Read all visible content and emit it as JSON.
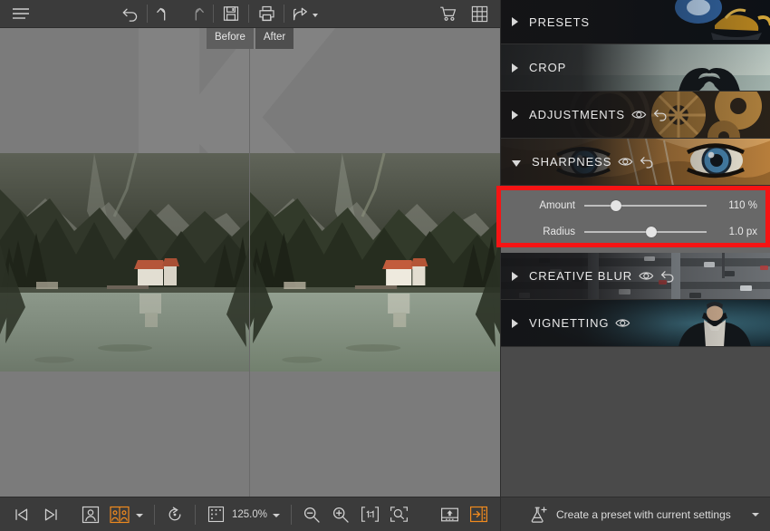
{
  "app": {
    "accent_color": "#f08a1e",
    "annotation_color": "#f51414",
    "panel_bg": "#4a4a4a",
    "toolbar_bg": "#3b3b3b",
    "slider_panel_bg": "#686868"
  },
  "top_toolbar": {
    "items": [
      {
        "name": "menu-icon",
        "title": "Menu"
      },
      {
        "name": "undo-all-icon",
        "title": "Undo all"
      },
      {
        "name": "undo-icon",
        "title": "Undo"
      },
      {
        "name": "redo-icon",
        "title": "Redo"
      },
      {
        "name": "save-icon",
        "title": "Save"
      },
      {
        "name": "print-icon",
        "title": "Print"
      },
      {
        "name": "share-icon",
        "title": "Share"
      },
      {
        "name": "cart-icon",
        "title": "Shop"
      },
      {
        "name": "grid-icon",
        "title": "Grid view"
      }
    ]
  },
  "canvas": {
    "tabs": [
      {
        "label": "Before",
        "selected": true
      },
      {
        "label": "After",
        "selected": false
      }
    ]
  },
  "bottom_toolbar": {
    "prev_label": "Previous image",
    "next_label": "Next image",
    "single_view_label": "Single view",
    "split_view_label": "Split before/after view",
    "rotate_label": "Rotate",
    "crop_indicator_label": "Selection",
    "zoom_value": "125.0%",
    "zoom_out_label": "Zoom out",
    "zoom_in_label": "Zoom in",
    "actual_size_label": "1:1",
    "fit_label": "Fit to screen",
    "export_label": "Export",
    "toggle_panel_label": "Toggle side panel"
  },
  "right_panel": {
    "sections": [
      {
        "id": "presets",
        "title": "PRESETS",
        "expanded": false,
        "has_eye": false,
        "has_reset": false,
        "thumb": "genie"
      },
      {
        "id": "crop",
        "title": "CROP",
        "expanded": false,
        "has_eye": false,
        "has_reset": false,
        "thumb": "hands"
      },
      {
        "id": "adjustments",
        "title": "ADJUSTMENTS",
        "expanded": false,
        "has_eye": true,
        "has_reset": true,
        "thumb": "gears"
      },
      {
        "id": "sharpness",
        "title": "SHARPNESS",
        "expanded": true,
        "has_eye": true,
        "has_reset": true,
        "thumb": "tiger"
      },
      {
        "id": "creative-blur",
        "title": "CREATIVE BLUR",
        "expanded": false,
        "has_eye": true,
        "has_reset": true,
        "thumb": "traffic"
      },
      {
        "id": "vignetting",
        "title": "VIGNETTING",
        "expanded": false,
        "has_eye": true,
        "has_reset": false,
        "thumb": "tux"
      }
    ],
    "sharpness_sliders": [
      {
        "label": "Amount",
        "value": "110 %",
        "position_pct": 26
      },
      {
        "label": "Radius",
        "value": "1.0 px",
        "position_pct": 55
      }
    ]
  },
  "preset_bar": {
    "label": "Create a preset with current settings",
    "icon": "flask-plus-icon"
  }
}
